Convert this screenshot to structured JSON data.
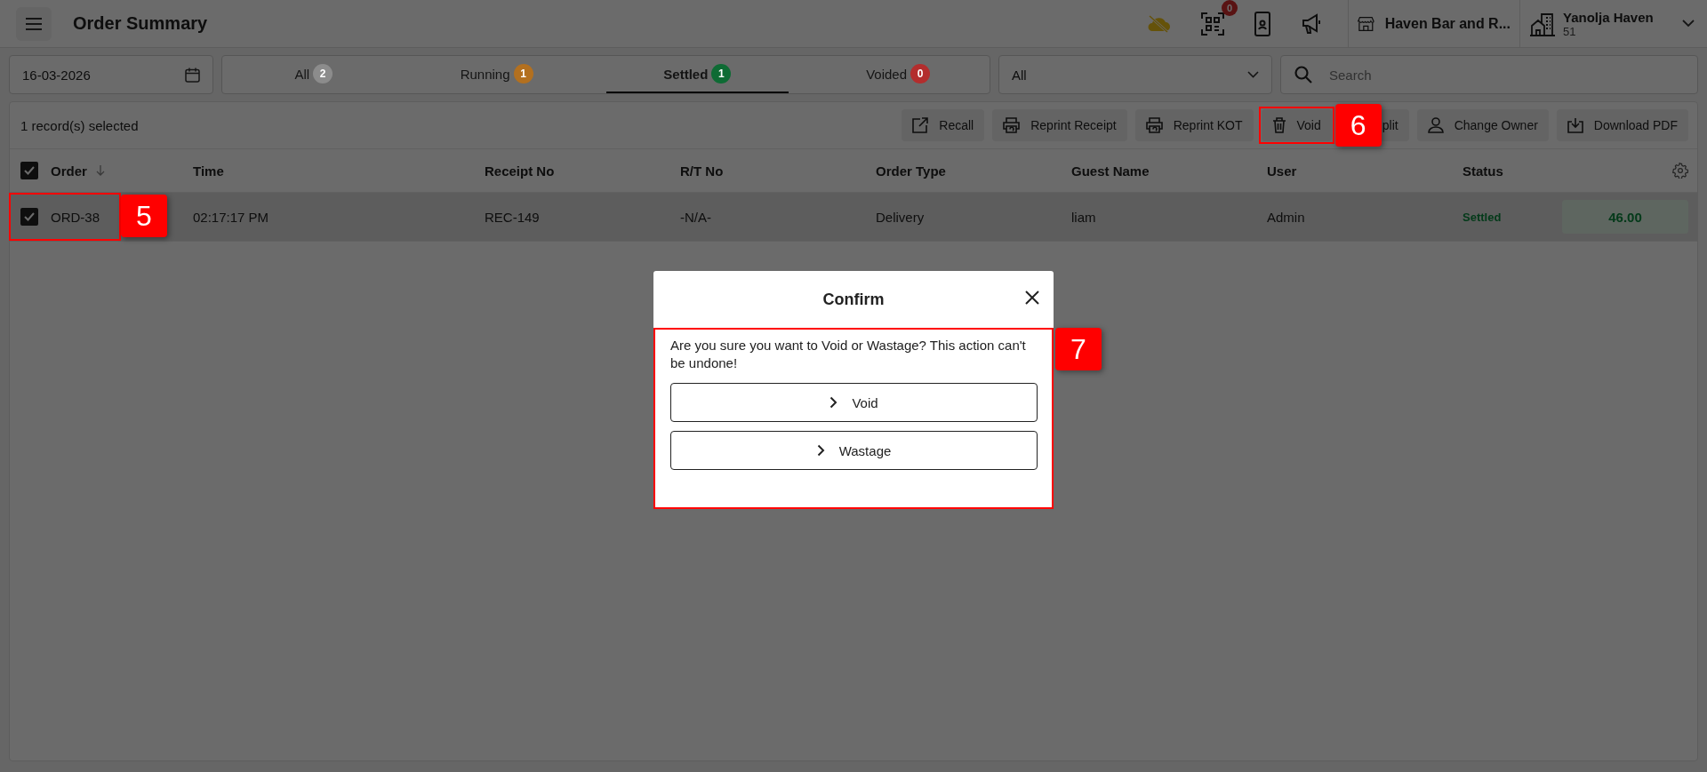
{
  "header": {
    "title": "Order Summary",
    "qr_badge": "0",
    "store": "Haven Bar and R...",
    "user": {
      "name": "Yanolja Haven",
      "sub": "51"
    }
  },
  "filters": {
    "date": "16-03-2026",
    "tabs": [
      {
        "label": "All",
        "count": "2",
        "color": "#8c8c8c",
        "selected": false
      },
      {
        "label": "Running",
        "count": "1",
        "color": "#b3701f",
        "selected": false
      },
      {
        "label": "Settled",
        "count": "1",
        "color": "#0e6b34",
        "selected": true
      },
      {
        "label": "Voided",
        "count": "0",
        "color": "#b32d2d",
        "selected": false
      }
    ],
    "order_select": "All",
    "search": {
      "placeholder": "Search"
    }
  },
  "toolbar": {
    "selection": "1 record(s) selected",
    "actions": [
      {
        "kind": "recall",
        "label": "Recall"
      },
      {
        "kind": "reprint",
        "label": "Reprint Receipt"
      },
      {
        "kind": "reprint",
        "label": "Reprint KOT"
      },
      {
        "kind": "void",
        "label": "Void",
        "callout": "6"
      },
      {
        "kind": "split",
        "label": "plit"
      },
      {
        "kind": "owner",
        "label": "Change Owner"
      },
      {
        "kind": "download",
        "label": "Download PDF"
      }
    ]
  },
  "table": {
    "header_checked": true,
    "columns": [
      "Order",
      "Time",
      "Receipt No",
      "R/T No",
      "Order Type",
      "Guest Name",
      "User",
      "Status"
    ],
    "rows": [
      {
        "selected": true,
        "checked": true,
        "order": "ORD-38",
        "time": "02:17:17 PM",
        "receipt": "REC-149",
        "rt": "-N/A-",
        "type": "Delivery",
        "guest": "liam",
        "user": "Admin",
        "status": "Settled",
        "amount": "46.00",
        "callout": "5"
      }
    ]
  },
  "dialog": {
    "title": "Confirm",
    "message": "Are you sure you want to Void or Wastage? This action can't be undone!",
    "options": [
      "Void",
      "Wastage"
    ],
    "callout": "7"
  }
}
